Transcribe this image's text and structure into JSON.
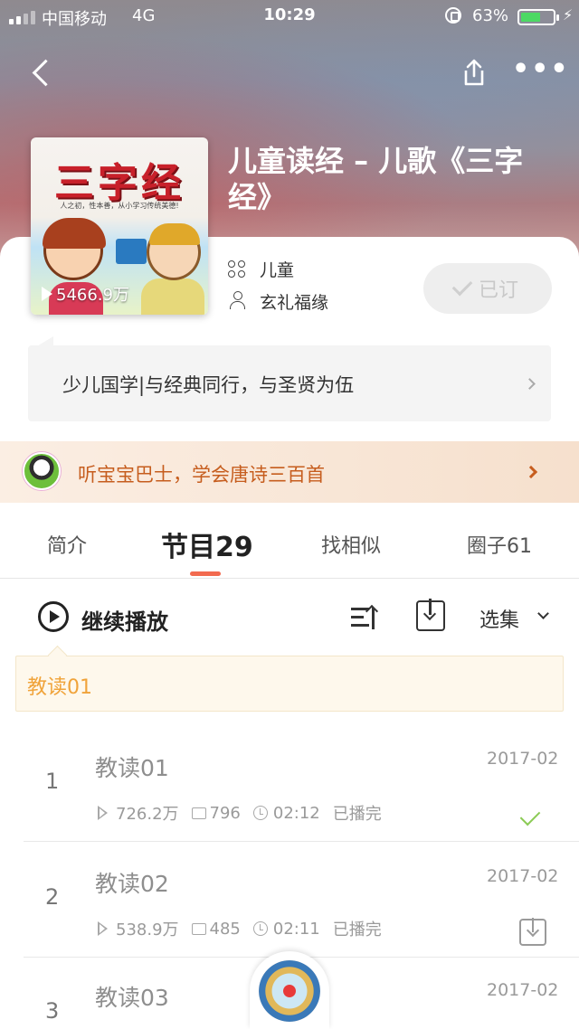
{
  "status_bar": {
    "carrier": "中国移动",
    "network": "4G",
    "time": "10:29",
    "battery_percent": "63%",
    "battery_level": 0.63,
    "battery_color": "#4cd964"
  },
  "header": {
    "back_icon": "chevron-left-icon",
    "share_icon": "share-icon",
    "more_icon": "more-dots-icon",
    "more_text": "•••"
  },
  "album": {
    "title": "儿童读经 – 儿歌《三字经》",
    "cover": {
      "title": "三字经",
      "subtitle": "人之初，性本善，从小学习传统美德!",
      "play_count": "5466.9万"
    },
    "category": "儿童",
    "author": "玄礼福缘",
    "subscribe_label": "已订",
    "intro": "少儿国学|与经典同行，与圣贤为伍"
  },
  "promo": {
    "text": "听宝宝巴士，学会唐诗三百首"
  },
  "tabs": [
    {
      "label": "简介",
      "active": false
    },
    {
      "label": "节目29",
      "active": true
    },
    {
      "label": "找相似",
      "active": false
    },
    {
      "label": "圈子61",
      "active": false
    }
  ],
  "accent_color": "#f26a4f",
  "toolbar": {
    "continue_label": "继续播放",
    "select_label": "选集"
  },
  "last_played": "教读01",
  "episodes": [
    {
      "index": "1",
      "title": "教读01",
      "date": "2017-02",
      "plays": "726.2万",
      "comments": "796",
      "duration": "02:12",
      "status": "已播完",
      "action": "played-check"
    },
    {
      "index": "2",
      "title": "教读02",
      "date": "2017-02",
      "plays": "538.9万",
      "comments": "485",
      "duration": "02:11",
      "status": "已播完",
      "action": "download"
    },
    {
      "index": "3",
      "title": "教读03",
      "date": "2017-02"
    }
  ]
}
